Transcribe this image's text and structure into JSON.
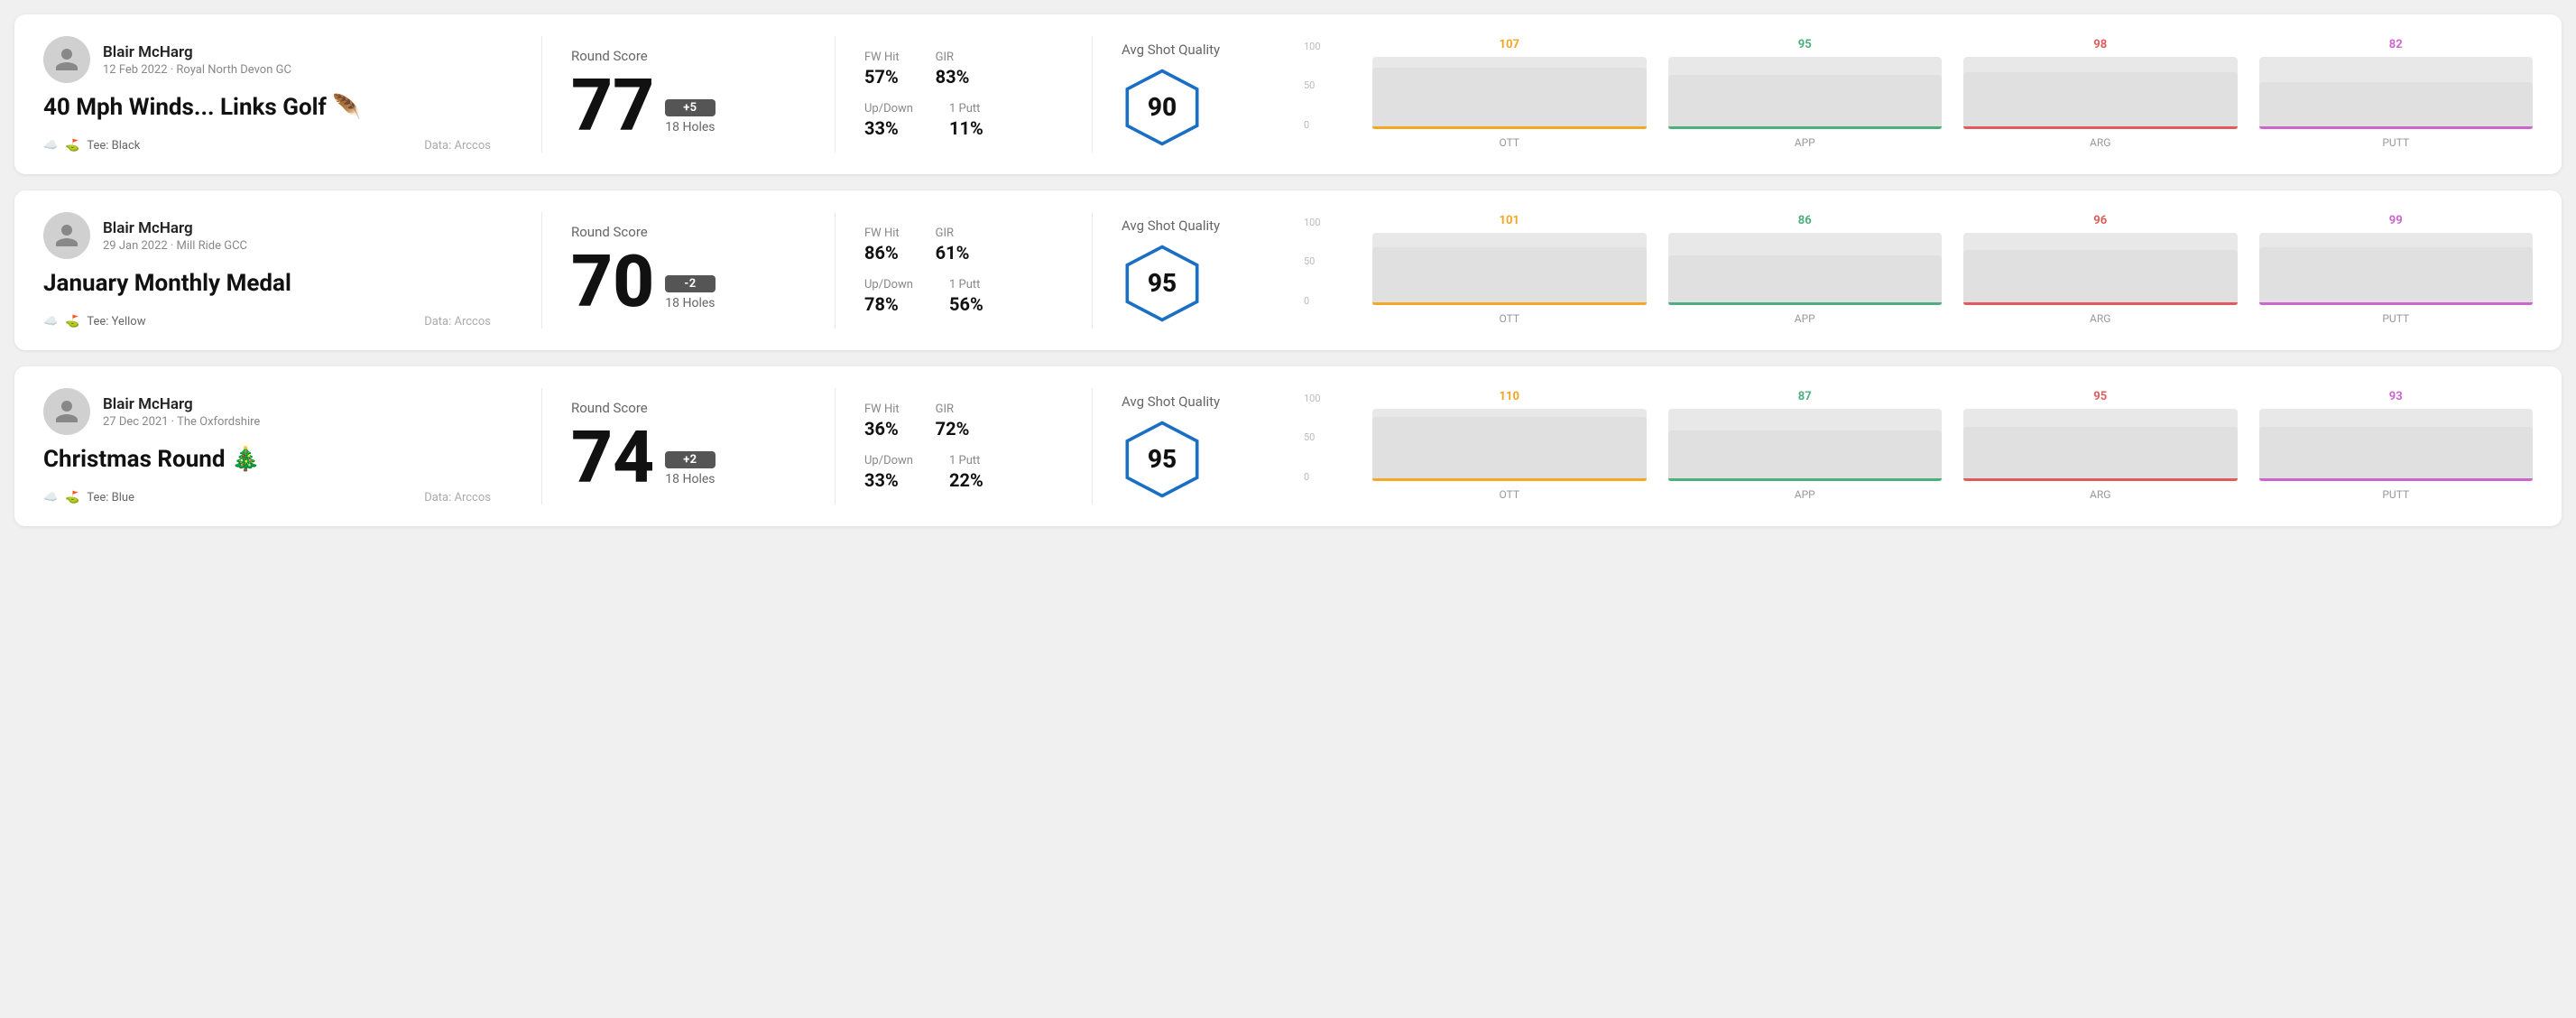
{
  "rounds": [
    {
      "id": "round-1",
      "user_name": "Blair McHarg",
      "date_venue": "12 Feb 2022 · Royal North Devon GC",
      "title": "40 Mph Winds... Links Golf 🪶",
      "tee": "Black",
      "data_source": "Data: Arccos",
      "score": "77",
      "score_badge": "+5",
      "holes": "18 Holes",
      "score_label": "Round Score",
      "fw_hit_label": "FW Hit",
      "fw_hit_value": "57%",
      "gir_label": "GIR",
      "gir_value": "83%",
      "up_down_label": "Up/Down",
      "up_down_value": "33%",
      "one_putt_label": "1 Putt",
      "one_putt_value": "11%",
      "quality_label": "Avg Shot Quality",
      "quality_score": "90",
      "chart": {
        "columns": [
          {
            "label": "OTT",
            "value": 107,
            "color": "#f5a623",
            "bar_pct": 85
          },
          {
            "label": "APP",
            "value": 95,
            "color": "#4caf7d",
            "bar_pct": 75
          },
          {
            "label": "ARG",
            "value": 98,
            "color": "#e05c5c",
            "bar_pct": 78
          },
          {
            "label": "PUTT",
            "value": 82,
            "color": "#cc66cc",
            "bar_pct": 65
          }
        ],
        "y_labels": [
          "100",
          "50",
          "0"
        ]
      }
    },
    {
      "id": "round-2",
      "user_name": "Blair McHarg",
      "date_venue": "29 Jan 2022 · Mill Ride GCC",
      "title": "January Monthly Medal",
      "tee": "Yellow",
      "data_source": "Data: Arccos",
      "score": "70",
      "score_badge": "-2",
      "holes": "18 Holes",
      "score_label": "Round Score",
      "fw_hit_label": "FW Hit",
      "fw_hit_value": "86%",
      "gir_label": "GIR",
      "gir_value": "61%",
      "up_down_label": "Up/Down",
      "up_down_value": "78%",
      "one_putt_label": "1 Putt",
      "one_putt_value": "56%",
      "quality_label": "Avg Shot Quality",
      "quality_score": "95",
      "chart": {
        "columns": [
          {
            "label": "OTT",
            "value": 101,
            "color": "#f5a623",
            "bar_pct": 80
          },
          {
            "label": "APP",
            "value": 86,
            "color": "#4caf7d",
            "bar_pct": 68
          },
          {
            "label": "ARG",
            "value": 96,
            "color": "#e05c5c",
            "bar_pct": 76
          },
          {
            "label": "PUTT",
            "value": 99,
            "color": "#cc66cc",
            "bar_pct": 79
          }
        ],
        "y_labels": [
          "100",
          "50",
          "0"
        ]
      }
    },
    {
      "id": "round-3",
      "user_name": "Blair McHarg",
      "date_venue": "27 Dec 2021 · The Oxfordshire",
      "title": "Christmas Round 🎄",
      "tee": "Blue",
      "data_source": "Data: Arccos",
      "score": "74",
      "score_badge": "+2",
      "holes": "18 Holes",
      "score_label": "Round Score",
      "fw_hit_label": "FW Hit",
      "fw_hit_value": "36%",
      "gir_label": "GIR",
      "gir_value": "72%",
      "up_down_label": "Up/Down",
      "up_down_value": "33%",
      "one_putt_label": "1 Putt",
      "one_putt_value": "22%",
      "quality_label": "Avg Shot Quality",
      "quality_score": "95",
      "chart": {
        "columns": [
          {
            "label": "OTT",
            "value": 110,
            "color": "#f5a623",
            "bar_pct": 88
          },
          {
            "label": "APP",
            "value": 87,
            "color": "#4caf7d",
            "bar_pct": 69
          },
          {
            "label": "ARG",
            "value": 95,
            "color": "#e05c5c",
            "bar_pct": 75
          },
          {
            "label": "PUTT",
            "value": 93,
            "color": "#cc66cc",
            "bar_pct": 74
          }
        ],
        "y_labels": [
          "100",
          "50",
          "0"
        ]
      }
    }
  ]
}
